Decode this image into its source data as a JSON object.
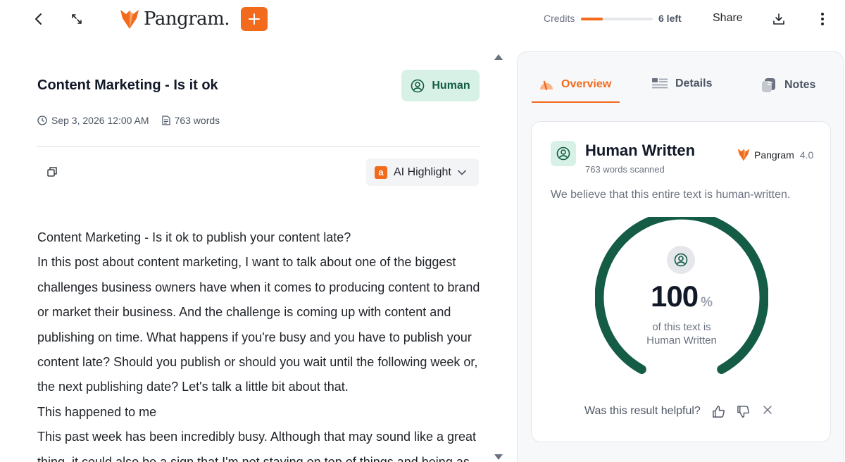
{
  "app": {
    "brand_name": "Pangram.",
    "accent_color": "#f26b1d",
    "human_color": "#145c45"
  },
  "toolbar": {
    "back_icon": "chevron-left-icon",
    "expand_icon": "expand-arrows-icon",
    "new_icon": "plus-icon",
    "credits_label": "Credits",
    "credits_fraction": 0.3,
    "credits_left": "6 left",
    "share_label": "Share",
    "download_icon": "download-icon",
    "more_icon": "more-vertical-icon"
  },
  "document": {
    "title": "Content Marketing - Is it ok",
    "status_badge": "Human",
    "date": "Sep 3, 2026 12:00 AM",
    "word_count": "763 words",
    "highlight_selector": "AI Highlight",
    "paragraphs": [
      "Content Marketing - Is it ok to publish your content late?",
      "In this post about content marketing, I want to talk about one of the biggest",
      "challenges business owners have when it comes to producing content to brand",
      "or market their business. And the challenge is coming up with content and",
      "publishing on time. What happens if you're busy and you have to publish your",
      "content late? Should you publish or should you wait until the following week or,",
      "the next publishing date? Let's talk a little bit about that.",
      "This happened to me",
      "This past week has been incredibly busy. Although that may sound like a great",
      "thing, it could also be a sign that I'm not staying on top of things and being as"
    ]
  },
  "panel": {
    "tabs": [
      {
        "label": "Overview",
        "icon": "gauge-icon"
      },
      {
        "label": "Details",
        "icon": "list-icon"
      },
      {
        "label": "Notes",
        "icon": "notes-icon"
      }
    ],
    "card": {
      "title": "Human Written",
      "subtitle": "763 words scanned",
      "model_name": "Pangram",
      "model_version": "4.0",
      "belief": "We believe that this entire text is human-written.",
      "score": "100",
      "score_unit": "%",
      "score_fraction": 1.0,
      "caption_line1": "of this text is",
      "caption_line2": "Human Written",
      "helpful_prompt": "Was this result helpful?"
    }
  }
}
